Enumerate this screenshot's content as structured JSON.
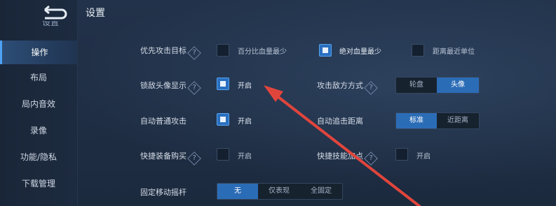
{
  "page_title": "设置",
  "sidebar": {
    "partial_label": "设置",
    "items": [
      {
        "label": "操作",
        "active": true
      },
      {
        "label": "布局",
        "active": false
      },
      {
        "label": "局内音效",
        "active": false
      },
      {
        "label": "录像",
        "active": false
      },
      {
        "label": "功能/隐私",
        "active": false
      },
      {
        "label": "下载管理",
        "active": false
      }
    ]
  },
  "settings": {
    "priority_target": {
      "label": "优先攻击目标",
      "options": [
        {
          "label": "百分比血量最少",
          "checked": false
        },
        {
          "label": "绝对血量最少",
          "checked": true
        },
        {
          "label": "距离最近单位",
          "checked": false
        }
      ]
    },
    "lock_avatar": {
      "label": "锁敌头像显示",
      "option": "开启",
      "checked": true
    },
    "attack_enemy_mode": {
      "label": "攻击敌方方式",
      "options": [
        "轮盘",
        "头像"
      ],
      "selected": "头像"
    },
    "auto_attack": {
      "label": "自动普通攻击",
      "option": "开启",
      "checked": true
    },
    "auto_chase": {
      "label": "自动追击距离",
      "options": [
        "标准",
        "近距离"
      ],
      "selected": "标准"
    },
    "quick_buy": {
      "label": "快捷装备购买",
      "option": "开启",
      "checked": false
    },
    "quick_skill": {
      "label": "快捷技能加点",
      "option": "开启",
      "checked": false
    },
    "fixed_joystick": {
      "label": "固定移动摇杆",
      "options": [
        "无",
        "仅表现",
        "全固定"
      ],
      "selected": "无"
    }
  },
  "colors": {
    "accent": "#2b6cb6",
    "arrow": "#e0453c"
  },
  "icons": {
    "help": "help-diamond-icon",
    "back": "back-arrow-icon"
  }
}
